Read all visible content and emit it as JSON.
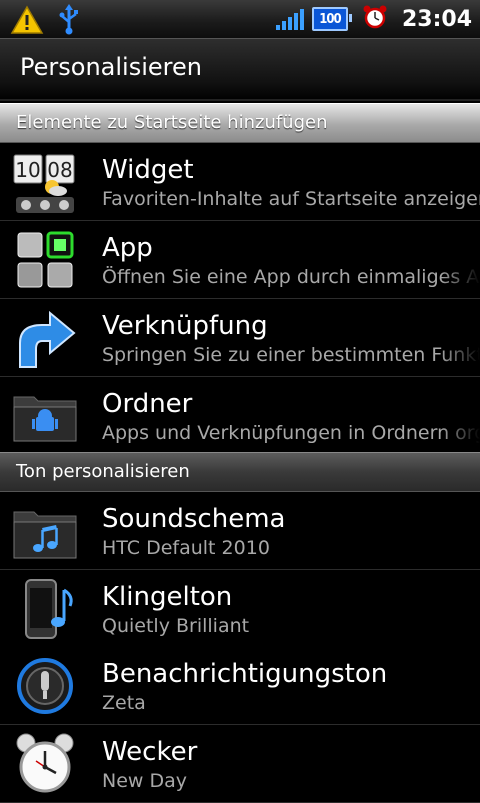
{
  "status_bar": {
    "clock": "23:04",
    "battery": "100",
    "icons": [
      "warning-icon",
      "usb-icon",
      "signal-icon",
      "battery-icon",
      "alarm-icon"
    ]
  },
  "title": "Personalisieren",
  "sections": [
    {
      "header": "Elemente zu Startseite hinzufügen",
      "items": [
        {
          "title": "Widget",
          "subtitle": "Favoriten-Inhalte auf Startseite anzeigen",
          "icon": "widget-clock-icon"
        },
        {
          "title": "App",
          "subtitle": "Öffnen Sie eine App durch einmaliges Ar",
          "icon": "app-grid-icon"
        },
        {
          "title": "Verknüpfung",
          "subtitle": "Springen Sie zu einer bestimmten Funkt",
          "icon": "shortcut-arrow-icon"
        },
        {
          "title": "Ordner",
          "subtitle": "Apps und Verknüpfungen in Ordnern orga",
          "icon": "folder-android-icon"
        }
      ]
    },
    {
      "header": "Ton personalisieren",
      "items": [
        {
          "title": "Soundschema",
          "subtitle": "HTC Default 2010",
          "icon": "sound-folder-icon"
        },
        {
          "title": "Klingelton",
          "subtitle": "Quietly Brilliant",
          "icon": "ringtone-phone-icon"
        },
        {
          "title": "Benachrichtigungston",
          "subtitle": "Zeta",
          "icon": "notification-sound-icon"
        },
        {
          "title": "Wecker",
          "subtitle": "New Day",
          "icon": "alarm-clock-icon"
        }
      ]
    }
  ]
}
